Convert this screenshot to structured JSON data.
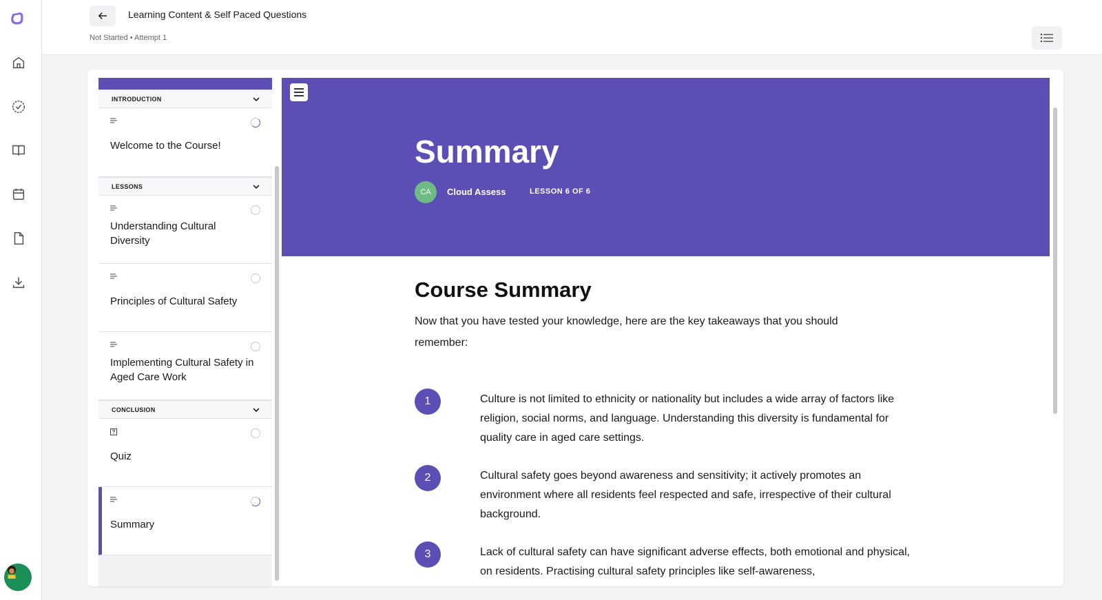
{
  "colors": {
    "accent": "#5b4fb5",
    "author_avatar_bg": "#6fbb86"
  },
  "rail": {
    "icons": [
      "logo-icon",
      "home-icon",
      "check-circle-icon",
      "book-open-icon",
      "calendar-icon",
      "document-icon",
      "download-icon"
    ]
  },
  "header": {
    "title": "Learning Content & Self Paced Questions",
    "status": "Not Started • Attempt 1"
  },
  "sidebar": {
    "sections": [
      {
        "label": "INTRODUCTION",
        "items": [
          {
            "label": "Welcome to the Course!",
            "type": "text",
            "progress": "partial"
          }
        ]
      },
      {
        "label": "LESSONS",
        "items": [
          {
            "label": "Understanding Cultural Diversity",
            "type": "text",
            "progress": "none"
          },
          {
            "label": "Principles of Cultural Safety",
            "type": "text",
            "progress": "none"
          },
          {
            "label": "Implementing Cultural Safety in Aged Care Work",
            "type": "text",
            "progress": "none"
          }
        ]
      },
      {
        "label": "CONCLUSION",
        "items": [
          {
            "label": "Quiz",
            "type": "quiz",
            "progress": "none"
          },
          {
            "label": "Summary",
            "type": "text",
            "progress": "partial",
            "active": true
          }
        ]
      }
    ]
  },
  "main": {
    "hero_title": "Summary",
    "author_initials": "CA",
    "author_name": "Cloud Assess",
    "lesson_position": "LESSON 6 OF 6",
    "section_title": "Course Summary",
    "intro": "Now that you have tested your knowledge, here are the key takeaways that you should remember:",
    "takeaways": [
      {
        "number": "1",
        "text": "Culture is not limited to ethnicity or nationality but includes a wide array of factors like religion, social norms, and language. Understanding this diversity is fundamental for quality care in aged care settings."
      },
      {
        "number": "2",
        "text": "Cultural safety goes beyond awareness and sensitivity; it actively promotes an environment where all residents feel respected and safe, irrespective of their cultural background."
      },
      {
        "number": "3",
        "text": "Lack of cultural safety can have significant adverse effects, both emotional and physical, on residents. Practising cultural safety principles like self-awareness,"
      }
    ]
  }
}
